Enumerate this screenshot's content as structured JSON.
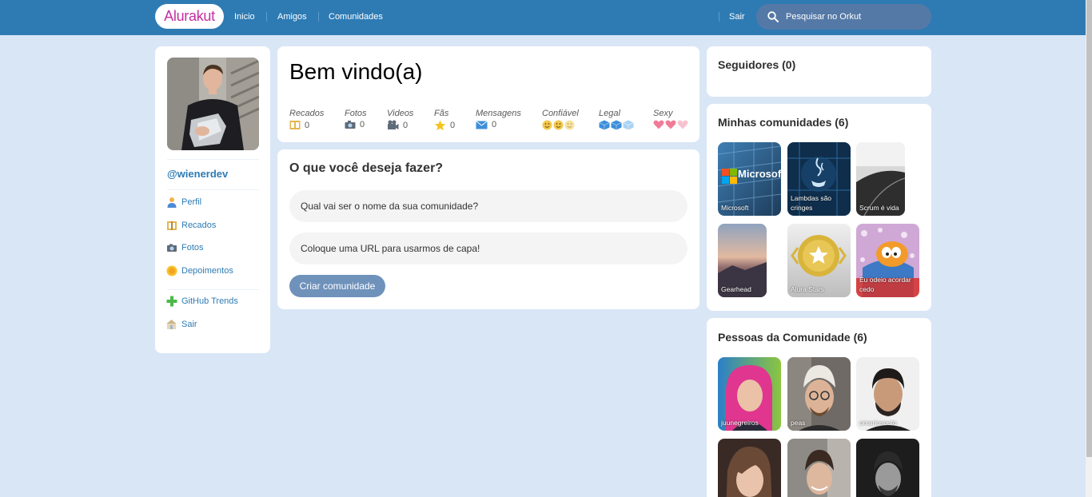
{
  "header": {
    "logo": "Alurakut",
    "nav": [
      "Inicio",
      "Amigos",
      "Comunidades"
    ],
    "logout": "Sair",
    "search_placeholder": "Pesquisar no Orkut"
  },
  "profile": {
    "handle": "@wienerdev",
    "menu": [
      {
        "label": "Perfil",
        "icon": "user-icon"
      },
      {
        "label": "Recados",
        "icon": "book-icon"
      },
      {
        "label": "Fotos",
        "icon": "camera-icon"
      },
      {
        "label": "Depoimentos",
        "icon": "sun-icon"
      }
    ],
    "menu2": [
      {
        "label": "GitHub Trends",
        "icon": "plus-icon"
      },
      {
        "label": "Sair",
        "icon": "logout-icon"
      }
    ]
  },
  "welcome": {
    "title": "Bem vindo(a)",
    "stats": [
      {
        "label": "Recados",
        "value": "0",
        "icon": "book-icon"
      },
      {
        "label": "Fotos",
        "value": "0",
        "icon": "camera-icon"
      },
      {
        "label": "Videos",
        "value": "0",
        "icon": "video-camera-icon"
      },
      {
        "label": "Fãs",
        "value": "0",
        "icon": "star-icon"
      },
      {
        "label": "Mensagens",
        "value": "0",
        "icon": "envelope-icon"
      },
      {
        "label": "Confiável",
        "value": 2,
        "max": 3,
        "icon": "smiley-icon"
      },
      {
        "label": "Legal",
        "value": 2,
        "max": 3,
        "icon": "ice-cube-icon"
      },
      {
        "label": "Sexy",
        "value": 2,
        "max": 3,
        "icon": "heart-icon"
      }
    ]
  },
  "form": {
    "title": "O que você deseja fazer?",
    "name_placeholder": "Qual vai ser o nome da sua comunidade?",
    "url_placeholder": "Coloque uma URL para usarmos de capa!",
    "submit": "Criar comunidade"
  },
  "followers": {
    "title": "Seguidores (0)"
  },
  "communities": {
    "title": "Minhas comunidades (6)",
    "items": [
      "Microsoft",
      "Lambdas são cringes",
      "Scrum é vida",
      "Gearhead",
      "Alura Stars",
      "Eu odeio acordar cedo"
    ]
  },
  "people": {
    "title": "Pessoas da Comunidade (6)",
    "items": [
      "juunegreiros",
      "peas",
      "omariosouto",
      "",
      "",
      ""
    ]
  },
  "colors": {
    "header": "#2E7BB4",
    "background": "#D9E6F6",
    "logo_text": "#C42FA0",
    "link": "#2E7BB4",
    "button": "#6F92BB"
  }
}
